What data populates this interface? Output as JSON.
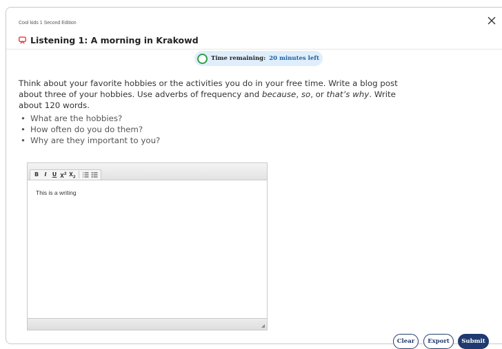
{
  "header": {
    "book_title": "Cool kids 1 Second Edition",
    "lesson_title": "Listening 1: A morning in Krakowd"
  },
  "timer": {
    "label": "Time remaining:",
    "value": "20 minutes left"
  },
  "prompt": {
    "text_1": "Think about your favorite hobbies or the activities you do in your free time. Write a blog post about three of your hobbies. Use adverbs of frequency and ",
    "em_1": "because",
    "text_2": ", ",
    "em_2": "so",
    "text_3": ", or ",
    "em_3": "that’s why",
    "text_4": ". Write about 120 words.",
    "bullets": [
      "What are the hobbies?",
      "How often do you do them?",
      "Why are they important to you?"
    ]
  },
  "editor": {
    "content": "This is a writing",
    "toolbar": {
      "bold": "B",
      "italic": "I",
      "underline": "U"
    }
  },
  "actions": {
    "clear": "Clear",
    "export": "Export",
    "submit": "Submit"
  },
  "colors": {
    "accent": "#1e3a6e",
    "timer_bg": "#dfeefa",
    "timer_ring": "#2e9e48",
    "lesson_icon": "#e53935"
  },
  "icons": {
    "close": "close-icon",
    "lesson": "presentation-icon"
  }
}
